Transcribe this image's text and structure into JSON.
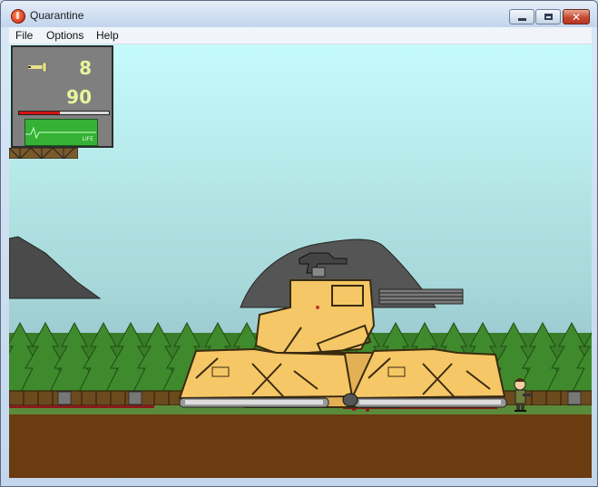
{
  "window": {
    "title": "Quarantine",
    "icon": "quarantine-app-icon"
  },
  "menu": {
    "items": [
      "File",
      "Options",
      "Help"
    ]
  },
  "hud": {
    "ammo": "8",
    "health": "90",
    "health_fraction": 0.45,
    "life_label": "LIFE",
    "icons": {
      "ammo": "bullet-icon",
      "monitor": "heartbeat-monitor-icon"
    }
  },
  "colors": {
    "sky_top": "#c3f7f7",
    "sky_bottom": "#8fbfcf",
    "tree_green": "#3f8a2c",
    "tank_body": "#f6c766",
    "ground_brown": "#6a3c10",
    "grass": "#5a8b3a",
    "hud_text": "#e9f59c",
    "health_red": "#d21414"
  }
}
